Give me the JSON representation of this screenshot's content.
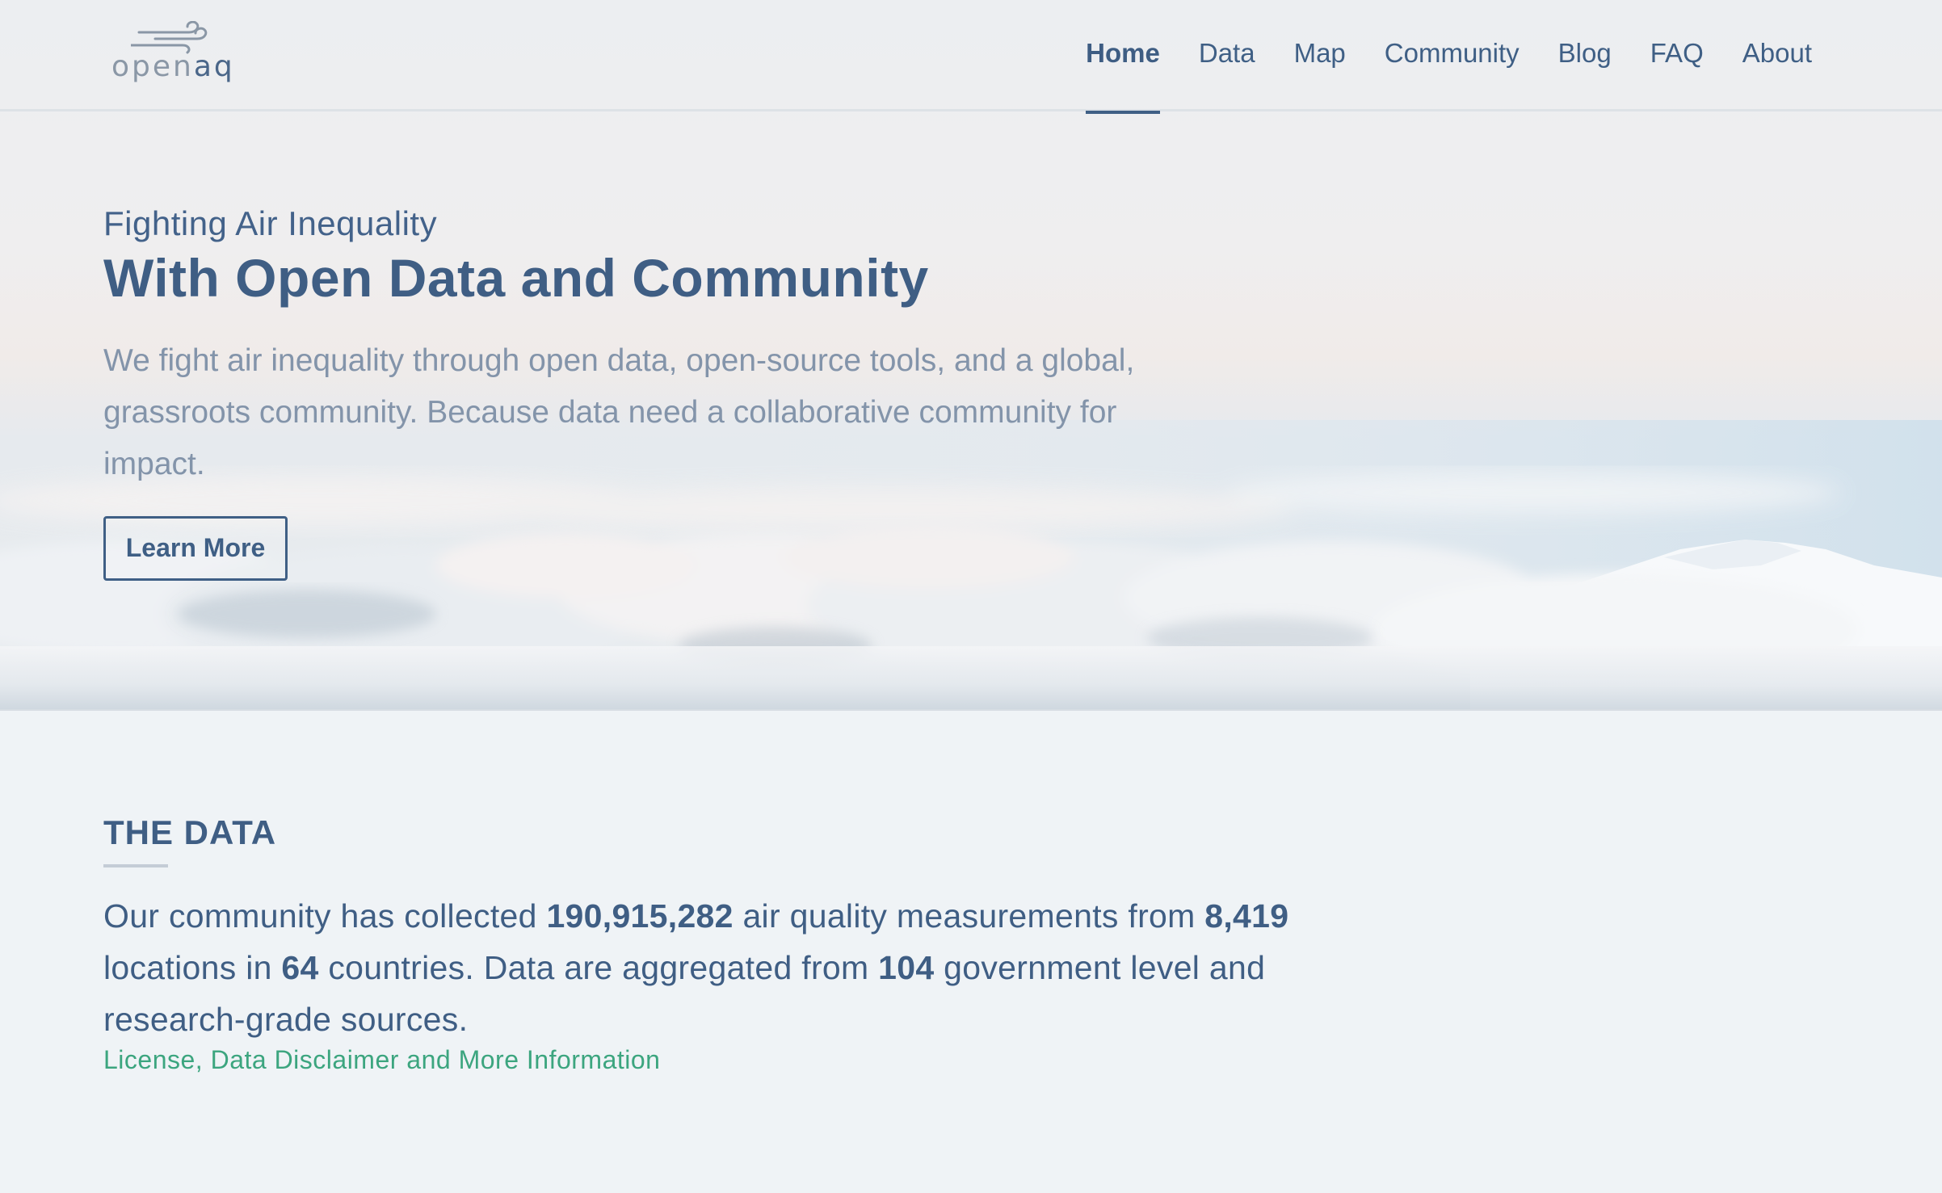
{
  "header": {
    "logo": {
      "text_open": "open",
      "text_aq": "aq"
    },
    "nav": [
      {
        "label": "Home",
        "active": true
      },
      {
        "label": "Data",
        "active": false
      },
      {
        "label": "Map",
        "active": false
      },
      {
        "label": "Community",
        "active": false
      },
      {
        "label": "Blog",
        "active": false
      },
      {
        "label": "FAQ",
        "active": false
      },
      {
        "label": "About",
        "active": false
      }
    ]
  },
  "hero": {
    "kicker": "Fighting Air Inequality",
    "title": "With Open Data and Community",
    "description": "We fight air inequality through open data, open-source tools, and a global, grassroots community. Because data need a collaborative community for impact.",
    "button_label": "Learn More"
  },
  "data_section": {
    "title": "THE DATA",
    "stats_text": {
      "part1": "Our community has collected ",
      "measurements": "190,915,282",
      "part2": " air quality measurements from ",
      "locations": "8,419",
      "part3": " locations in ",
      "countries": "64",
      "part4": " countries. Data are aggregated from ",
      "sources": "104",
      "part5": " government level and research-grade sources."
    },
    "link_label": "License, Data Disclaimer and More Information"
  },
  "colors": {
    "brand_navy": "#3f5f85",
    "link_green": "#3ca57f",
    "muted_text": "#8394aa",
    "page_bg": "#eff3f6"
  }
}
